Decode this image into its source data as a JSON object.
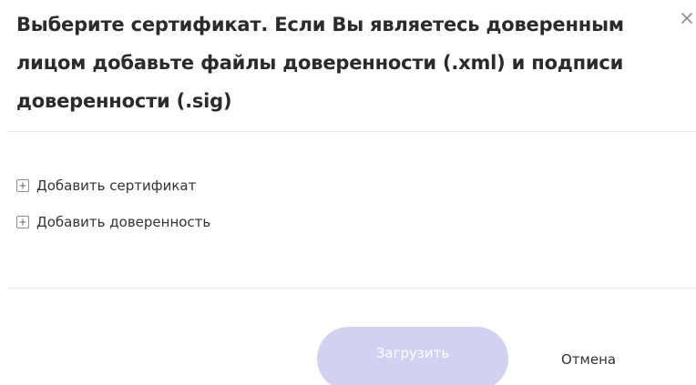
{
  "dialog": {
    "title": "Выберите сертификат. Если Вы являетесь доверенным лицом добавьте файлы доверенности (.xml) и подписи доверенности (.sig)",
    "close_icon": "close-icon",
    "close_symbol": "×"
  },
  "actions": [
    {
      "label": "Добавить сертификат",
      "icon": "plus-square-icon"
    },
    {
      "label": "Добавить доверенность",
      "icon": "plus-square-icon"
    }
  ],
  "footer": {
    "upload_label": "Загрузить",
    "cancel_label": "Отмена"
  },
  "colors": {
    "primary_disabled": "#d3d1f2",
    "text": "#2b2b2b",
    "divider": "#e8e8ee",
    "icon_gray": "#999999"
  }
}
